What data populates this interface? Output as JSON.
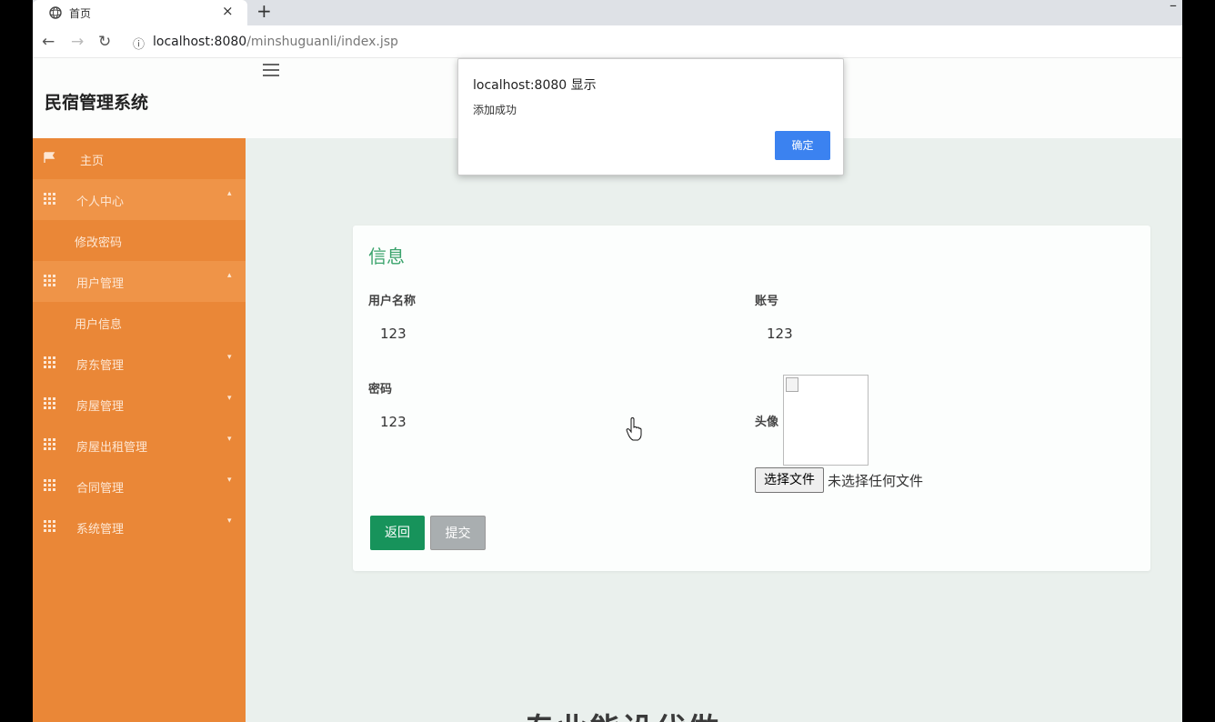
{
  "browser": {
    "tab_title": "首页",
    "new_tab": "+",
    "close": "×",
    "minimize": "–",
    "url_host": "localhost:8080",
    "url_path": "/minshuguanli/index.jsp"
  },
  "app": {
    "title": "民宿管理系统"
  },
  "sidebar": {
    "items": [
      {
        "label": "主页"
      },
      {
        "label": "个人中心"
      },
      {
        "label": "用户管理"
      },
      {
        "label": "房东管理"
      },
      {
        "label": "房屋管理"
      },
      {
        "label": "房屋出租管理"
      },
      {
        "label": "合同管理"
      },
      {
        "label": "系统管理"
      }
    ],
    "subitems": {
      "personal": "修改密码",
      "users": "用户信息"
    }
  },
  "form": {
    "title": "信息",
    "username_label": "用户名称",
    "username_value": "123",
    "account_label": "账号",
    "account_value": "123",
    "password_label": "密码",
    "password_value": "123",
    "avatar_label": "头像",
    "file_button": "选择文件",
    "file_status": "未选择任何文件",
    "back_button": "返回",
    "submit_button": "提交"
  },
  "footer_text": "专业能设代做",
  "dialog": {
    "title": "localhost:8080 显示",
    "message": "添加成功",
    "ok_button": "确定"
  },
  "colors": {
    "sidebar": "#ea8737",
    "accent_green": "#3aa36c",
    "back_button": "#17935b",
    "dialog_button": "#3b82f0"
  }
}
